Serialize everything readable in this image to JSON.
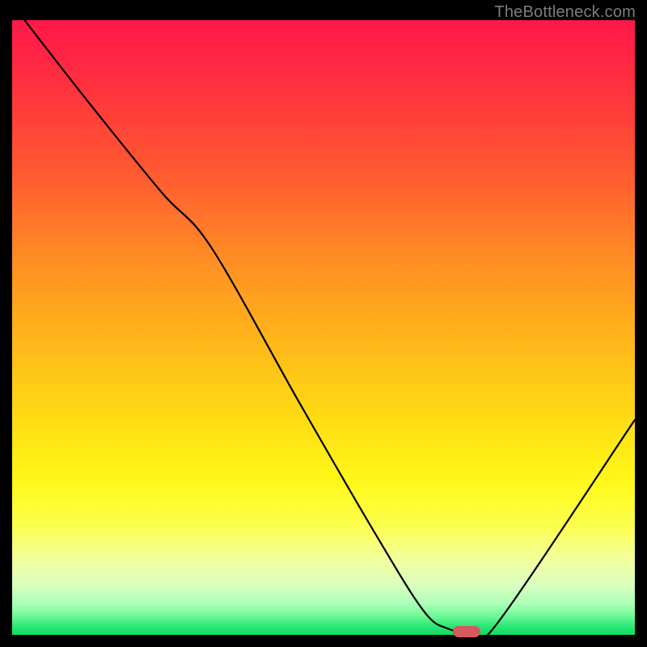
{
  "watermark": "TheBottleneck.com",
  "chart_data": {
    "type": "line",
    "title": "",
    "xlabel": "",
    "ylabel": "",
    "xlim": [
      0,
      100
    ],
    "ylim": [
      0,
      100
    ],
    "series": [
      {
        "name": "curve",
        "x": [
          2,
          12,
          24,
          32,
          46,
          58,
          66,
          70,
          74,
          78,
          100
        ],
        "y": [
          100,
          87,
          72,
          63,
          38,
          17,
          4,
          1,
          0.5,
          2,
          35
        ]
      }
    ],
    "marker": {
      "x": 73,
      "y": 0.5,
      "color": "#d35a5f"
    },
    "gradient_colors": {
      "top": "#ff184a",
      "middle": "#ffdc14",
      "bottom": "#11d95f"
    }
  }
}
